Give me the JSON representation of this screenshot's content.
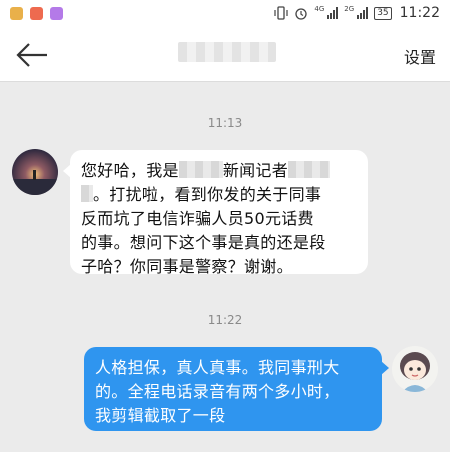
{
  "status_bar": {
    "network_1": "4G",
    "network_2": "2G",
    "battery": "35",
    "time": "11:22",
    "icons": [
      "vibrate-icon",
      "alarm-icon",
      "signal-icon",
      "battery-icon"
    ]
  },
  "header": {
    "back_icon": "arrow-left-icon",
    "contact_name": "█████",
    "settings_label": "设置"
  },
  "messages": [
    {
      "timestamp": "11:13",
      "direction": "incoming",
      "lines": [
        "您好哈，我是",
        "新闻记者",
        "。打扰啦，看到你发的关于同事",
        "反而坑了电信诈骗人员50元话费",
        "的事。想问下这个事是真的还是段",
        "子哈？你同事是警察？谢谢。"
      ]
    },
    {
      "timestamp": "11:22",
      "direction": "outgoing",
      "lines": [
        "人格担保，真人真事。我同事刑大",
        "的。全程电话录音有两个多小时，",
        "我剪辑截取了一段"
      ]
    }
  ],
  "colors": {
    "background": "#ebebeb",
    "outgoing_bubble": "#2f95ef",
    "incoming_bubble": "#ffffff"
  }
}
